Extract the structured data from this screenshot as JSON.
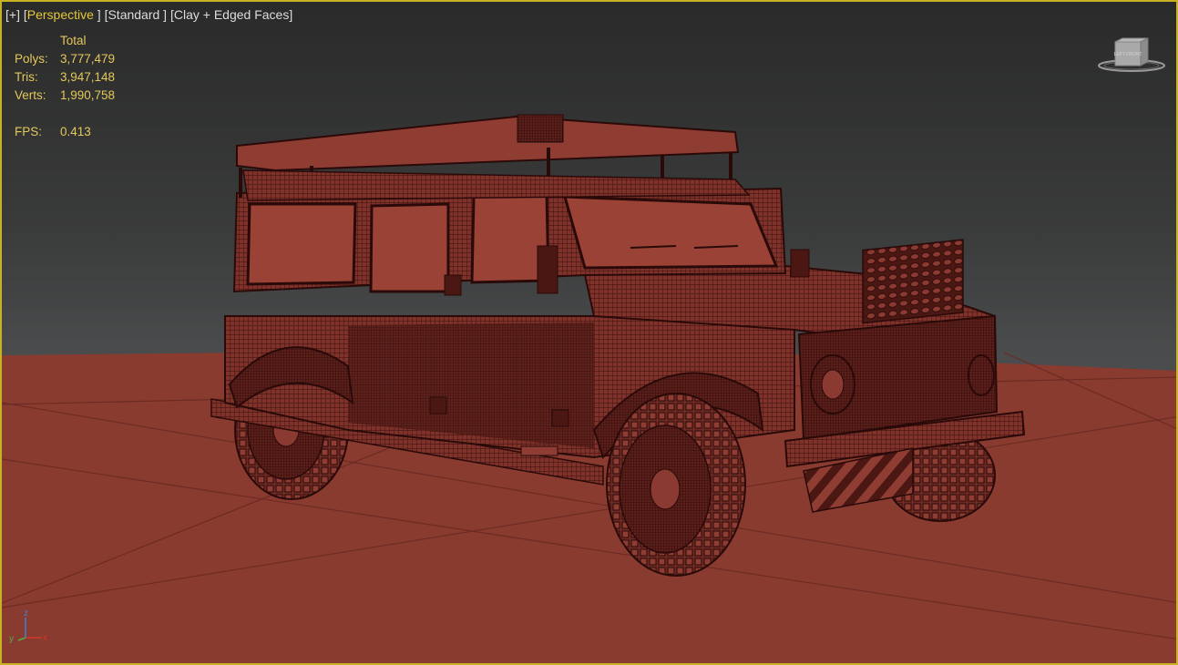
{
  "viewport": {
    "labels": {
      "plus": "[+]",
      "view": "Perspective",
      "shading_mode": "Standard",
      "display": "Clay + Edged Faces"
    },
    "colors": {
      "border": "#c7b224",
      "label_active": "#e3c83a",
      "stats_text": "#e4c85a",
      "clay": "#8a3a30",
      "wire": "#3a0f0e"
    }
  },
  "stats": {
    "header": "Total",
    "rows": [
      {
        "label": "Polys:",
        "value": "3,777,479"
      },
      {
        "label": "Tris:",
        "value": "3,947,148"
      },
      {
        "label": "Verts:",
        "value": "1,990,758"
      }
    ],
    "fps_label": "FPS:",
    "fps_value": "0.413"
  },
  "viewcube": {
    "icon": "viewcube-icon",
    "face_label": "LEFT FRONT"
  },
  "axis": {
    "x": "x",
    "y": "y",
    "z": "z"
  }
}
